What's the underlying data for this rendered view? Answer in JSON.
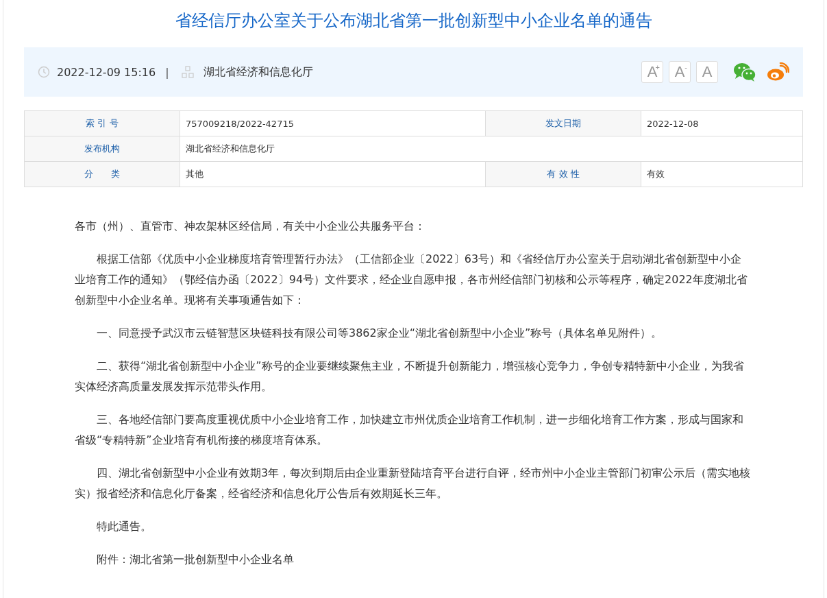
{
  "title": "省经信厅办公室关于公布湖北省第一批创新型中小企业名单的通告",
  "info_bar": {
    "datetime": "2022-12-09 15:16",
    "separator": "|",
    "publisher": "湖北省经济和信息化厅",
    "font_buttons": [
      {
        "label": "A",
        "mark": "+"
      },
      {
        "label": "A",
        "mark": "-"
      },
      {
        "label": "A"
      }
    ]
  },
  "meta_table": [
    [
      {
        "label": "索 引 号",
        "value": "757009218/2022-42715"
      },
      {
        "label": "发文日期",
        "value": "2022-12-08"
      }
    ],
    [
      {
        "label": "发布机构",
        "value": "湖北省经济和信息化厅"
      }
    ],
    [
      {
        "label": "分　　类",
        "value": "其他"
      },
      {
        "label": "有 效 性",
        "value": "有效"
      }
    ]
  ],
  "paragraphs": [
    {
      "kind": "salutation",
      "text": "各市（州）、直管市、神农架林区经信局，有关中小企业公共服务平台："
    },
    {
      "kind": "body",
      "text": "根据工信部《优质中小企业梯度培育管理暂行办法》（工信部企业〔2022〕63号）和《省经信厅办公室关于启动湖北省创新型中小企业培育工作的通知》（鄂经信办函〔2022〕94号）文件要求，经企业自愿申报，各市州经信部门初核和公示等程序，确定2022年度湖北省创新型中小企业名单。现将有关事项通告如下："
    },
    {
      "kind": "body",
      "text": "一、同意授予武汉市云链智慧区块链科技有限公司等3862家企业“湖北省创新型中小企业”称号（具体名单见附件）。"
    },
    {
      "kind": "body",
      "text": "二、获得“湖北省创新型中小企业”称号的企业要继续聚焦主业，不断提升创新能力，增强核心竞争力，争创专精特新中小企业，为我省实体经济高质量发展发挥示范带头作用。"
    },
    {
      "kind": "body",
      "text": "三、各地经信部门要高度重视优质中小企业培育工作，加快建立市州优质企业培育工作机制，进一步细化培育工作方案，形成与国家和省级“专精特新”企业培育有机衔接的梯度培育体系。"
    },
    {
      "kind": "body",
      "text": "四、湖北省创新型中小企业有效期3年，每次到期后由企业重新登陆培育平台进行自评，经市州中小企业主管部门初审公示后（需实地核实）报省经济和信息化厅备案，经省经济和信息化厅公告后有效期延长三年。"
    },
    {
      "kind": "body",
      "text": "特此通告。"
    },
    {
      "kind": "body",
      "text": "附件：湖北省第一批创新型中小企业名单"
    }
  ]
}
